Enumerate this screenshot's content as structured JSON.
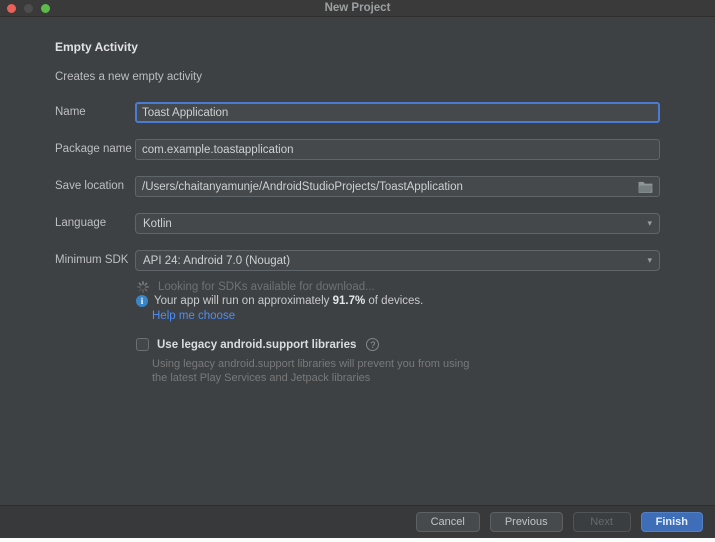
{
  "window": {
    "title": "New Project"
  },
  "header": {
    "title": "Empty Activity",
    "subtitle": "Creates a new empty activity"
  },
  "form": {
    "fields": [
      {
        "label": "Name",
        "value": "Toast Application"
      },
      {
        "label": "Package name",
        "value": "com.example.toastapplication"
      },
      {
        "label": "Save location",
        "value": "/Users/chaitanyamunje/AndroidStudioProjects/ToastApplication"
      },
      {
        "label": "Language",
        "value": "Kotlin"
      },
      {
        "label": "Minimum SDK",
        "value": "API 24: Android 7.0 (Nougat)"
      }
    ],
    "sdk_info": {
      "loading_text": "Looking for SDKs available for download...",
      "device_prefix": "Your app will run on approximately ",
      "device_percent": "91.7%",
      "device_suffix": " of devices.",
      "help_link": "Help me choose"
    },
    "legacy": {
      "label": "Use legacy android.support libraries",
      "description_line1": "Using legacy android.support libraries will prevent you from using",
      "description_line2": "the latest Play Services and Jetpack libraries"
    }
  },
  "footer": {
    "cancel": "Cancel",
    "previous": "Previous",
    "next": "Next",
    "finish": "Finish"
  },
  "icons": {
    "dropdown_arrow": "▾",
    "help": "?",
    "info": "i"
  },
  "colors": {
    "panel": "#3e4143",
    "titlebar": "#3a3a3a",
    "focus_blue": "#4a7bd5",
    "link_blue": "#4f8df5",
    "finish_button": "#3e6eb8",
    "info_icon": "#3886c9",
    "traffic_close": "#e9615a",
    "traffic_zoom": "#5dbb49"
  }
}
